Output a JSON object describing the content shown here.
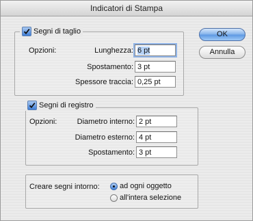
{
  "window": {
    "title": "Indicatori di Stampa"
  },
  "buttons": {
    "ok": "OK",
    "cancel": "Annulla"
  },
  "crop_marks": {
    "checkbox_label": "Segni di taglio",
    "checked": true,
    "options_label": "Opzioni:",
    "length_label": "Lunghezza:",
    "length_value": "6 pt",
    "offset_label": "Spostamento:",
    "offset_value": "3 pt",
    "weight_label": "Spessore traccia:",
    "weight_value": "0,25 pt"
  },
  "registration_marks": {
    "checkbox_label": "Segni di registro",
    "checked": true,
    "options_label": "Opzioni:",
    "inner_label": "Diametro interno:",
    "inner_value": "2 pt",
    "outer_label": "Diametro esterno:",
    "outer_value": "4 pt",
    "offset_label": "Spostamento:",
    "offset_value": "3 pt"
  },
  "create_marks": {
    "label": "Creare segni intorno:",
    "option_each_object": "ad ogni oggetto",
    "option_entire_selection": "all'intera selezione",
    "selected": "ad ogni oggetto"
  },
  "colors": {
    "accent": "#3f7ed6",
    "selection": "#b6d2f5"
  }
}
